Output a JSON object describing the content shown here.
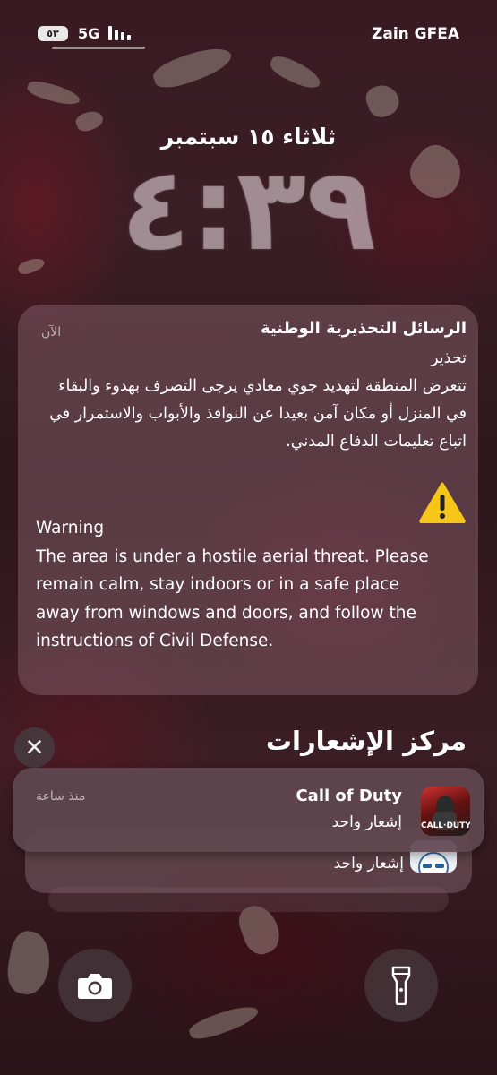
{
  "status_bar": {
    "battery": "٥٣",
    "network": "5G",
    "carrier": "Zain GFEA"
  },
  "lock_screen": {
    "date": "ثلاثاء ١٥ سبتمبر",
    "time": "٤:٣٩"
  },
  "alert": {
    "title": "الرسائل التحذيرية الوطنية",
    "time": "الآن",
    "icon": "warning-icon",
    "arabic_heading": "تحذير",
    "arabic_body": "تتعرض المنطقة لتهديد جوي معادي يرجى التصرف بهدوء والبقاء في المنزل أو مكان آمن بعيدا عن النوافذ والأبواب والاستمرار في اتباع تعليمات الدفاع المدني.",
    "english_heading": "Warning",
    "english_body": "The area is under a hostile aerial threat. Please remain calm, stay indoors or in a safe place away from windows and doors, and follow the instructions of Civil Defense."
  },
  "notification_center": {
    "title": "مركز الإشعارات",
    "close_label": "✕",
    "notifications": [
      {
        "app": "Call of Duty",
        "body": "إشعار واحد",
        "time": "منذ ساعة",
        "icon_text": "CALL·DUTY"
      },
      {
        "body": "إشعار واحد"
      }
    ]
  },
  "quick_actions": {
    "camera": "camera-icon",
    "flashlight": "flashlight-icon"
  },
  "colors": {
    "warning_yellow": "#f5c518",
    "card_bg": "#7d5a64"
  }
}
